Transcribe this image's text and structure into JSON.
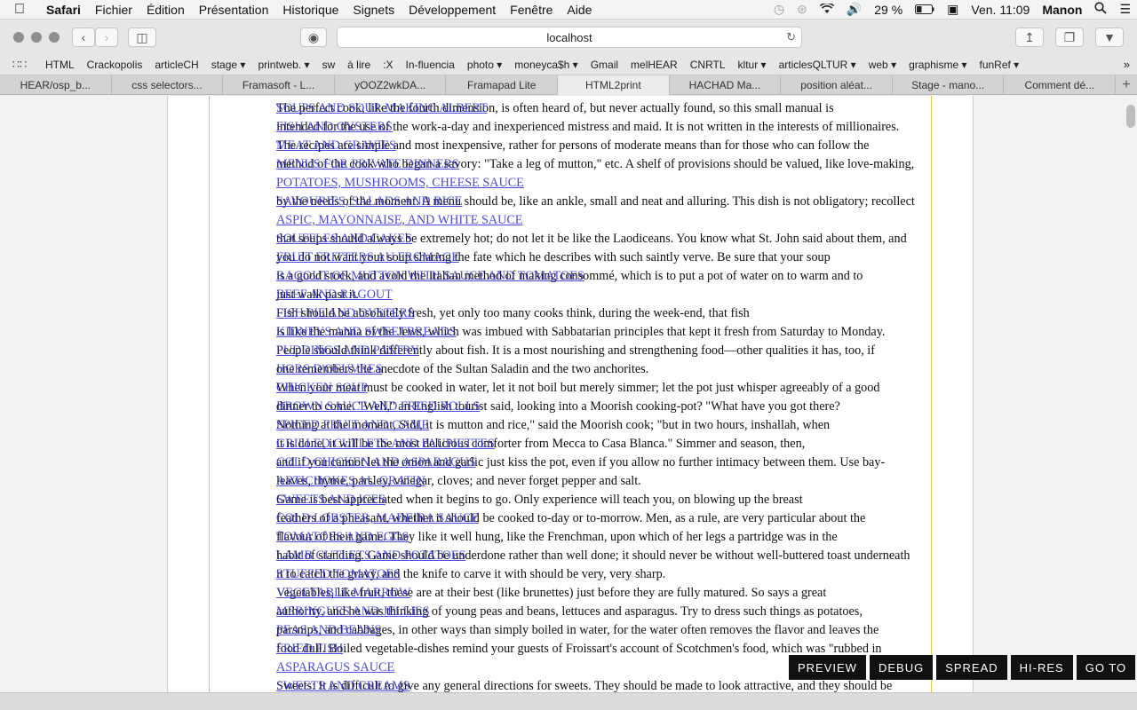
{
  "menubar": {
    "apple": "",
    "app": "Safari",
    "items": [
      "Fichier",
      "Édition",
      "Présentation",
      "Historique",
      "Signets",
      "Développement",
      "Fenêtre",
      "Aide"
    ],
    "battery": "29 %",
    "clock": "Ven. 11:09",
    "user": "Manon"
  },
  "toolbar": {
    "url": "localhost"
  },
  "bookmarks": [
    "HTML",
    "Crackopolis",
    "articleCH",
    "stage ▾",
    "printweb. ▾",
    "sw",
    "à lire",
    ":X",
    "In-fluencia",
    "photo ▾",
    "moneyca$h ▾",
    "Gmail",
    "melHEAR",
    "CNRTL",
    "kltur ▾",
    "articlesQLTUR ▾",
    "web ▾",
    "graphisme ▾",
    "funRef ▾"
  ],
  "tabs": [
    "HEAR/osp_b...",
    "css selectors...",
    "Framasoft - L...",
    "yOOZ2wkDA...",
    "Framapad Lite",
    "HTML2print",
    "HACHAD Ma...",
    "position aléat...",
    "Stage - mano...",
    "Comment dé..."
  ],
  "active_tab": 5,
  "page": {
    "body_lines": [
      "The perfect cook, like the fourth dimension, is often heard of, but never actually found, so this small manual is",
      "intended for the use of the work-a-day and inexperienced mistress and maid. It is not written in the interests of millionaires.",
      "The recipes are simple and most inexpensive, rather for persons of moderate means than for those who can follow the",
      "method of the cook who began a savory: \"Take a leg of mutton,\" etc. A shelf of provisions should be valued, like love-making,",
      "",
      "by the needs of the moment. A menu should be, like an ankle, small and neat and alluring. This dish is not obligatory; recollect",
      "",
      "that soups should always be extremely hot; do not let it be like the Laodiceans. You know what St. John said about them, and",
      "you do not want your soup sharing the fate which he describes with such saintly verve. Be sure that your soup",
      "is a good stock, and avoid the Italian method of making consommé, which is to put a pot of water on to warm and to",
      "just walk past it.",
      "Fish should be absolutely fresh, yet only too many cooks think, during the week-end, that fish",
      "is like the manna of the Jews, which was imbued with Sabbatarian principles that kept it fresh from Saturday to Monday.",
      "People should think differently about fish. It is a most nourishing and strengthening food—other qualities it has, too, if",
      "one remembers the anecdote of the Sultan Saladin and the two anchorites.",
      "When your meat must be cooked in water, let it not boil but merely simmer; let the pot just whisper agreeably of a good",
      "dinner to come. \"Well,\" an English tourist said, looking into a Moorish cooking-pot? \"What have you got there?",
      "Nothing at the moment, Sidi, it is mutton and rice,\" said the Moorish cook; \"but in two hours, inshallah, when",
      "it is done, it will be the most delicious comforter from Mecca to Casa Blanca.\" Simmer and season, then,",
      "and if you cannot let the onion and garlic just kiss the pot, even if you allow no further intimacy between them. Use bay-",
      "leaves, thyme, parsley, vinegar, cloves; and never forget pepper and salt.",
      "Game is best appreciated when it begins to go. Only experience will teach you, on blowing up the breast",
      "feathers of a pheasant, whether it should be cooked to-day or to-morrow. Men, as a rule, are very particular about the",
      "flavour of their game. They like it well hung, like the Frenchman, upon which of her legs a partridge was in the",
      "habit of standing. Game should be underdone rather than well done; it should never be without well-buttered toast underneath",
      "it to catch the gravy, and the knife to carve it with should be very, very sharp.",
      "Vegetables, like fruit, these are at their best (like brunettes) just before they are fully matured. So says a great",
      "authority, and he was thinking of young peas and beans, lettuces and asparagus. Try to dress such things as potatoes,",
      "parsnips, and cabbages, in other ways than simply boiled in water, for the water often removes the flavor and leaves the",
      "food dull. Boiled vegetable-dishes remind your guests of Froissart's account of Scotchmen's food, which was \"rubbed in",
      "",
      "Sweets: It is difficult to give any general directions for sweets. They should be made to look attractive, and they should be"
    ],
    "toc_lines": [
      "SOUPS AND SOUP-MAKING ALBERT",
      "FISH AND OYSTERS",
      "MEAT AND GRAVIES",
      "MENUS FOR PRIVATE DINNERS",
      "POTATOES, MUSHROOMS, CHEESE SAUCE",
      "SAVOURIES, SALADS AND RICE",
      "ASPIC, MAYONNAISE, AND WHITE SAUCE",
      "SOUFFLES AND CAKES",
      "FRUIT FRITTERS AU FROMAGE",
      "RAGOUT OF MUTTON WITH SAUCE AND TOMATOES",
      "BEEF AND RAGOUT",
      "FISH PIE AND OYSTERS",
      "KIDNEYS AND SWEETBREADS",
      "PUDDINGS AND PASTRY",
      "HORS D'OEUVRES",
      "CHICKEN SOUP",
      "BROWN SAUCE AND FRIED ROLLS",
      "SPICED FRUIT AND GAME",
      "GRILLED CUTLETS AND PAUPIETTES",
      "COLD CHICKEN AND ASPARAGUS",
      "ARTICHOKES AU GRATIN",
      "SWEETS AND ICES",
      "COLD LOBSTER, MADEIRA SAUCE",
      "TOMATOES AND EGGS",
      "LAMB CUTLETS AND POTATOES",
      "STUFFED TOMATOES",
      "VEGETABLE MARROW",
      "MERINGUES AND JELLIES",
      "PEAS AND BEANS",
      "FRIED FISH",
      "ASPARAGUS SAUCE",
      "SWEETS AND CREAMS"
    ]
  },
  "actions": [
    "PREVIEW",
    "DEBUG",
    "SPREAD",
    "HI-RES",
    "GO TO"
  ]
}
